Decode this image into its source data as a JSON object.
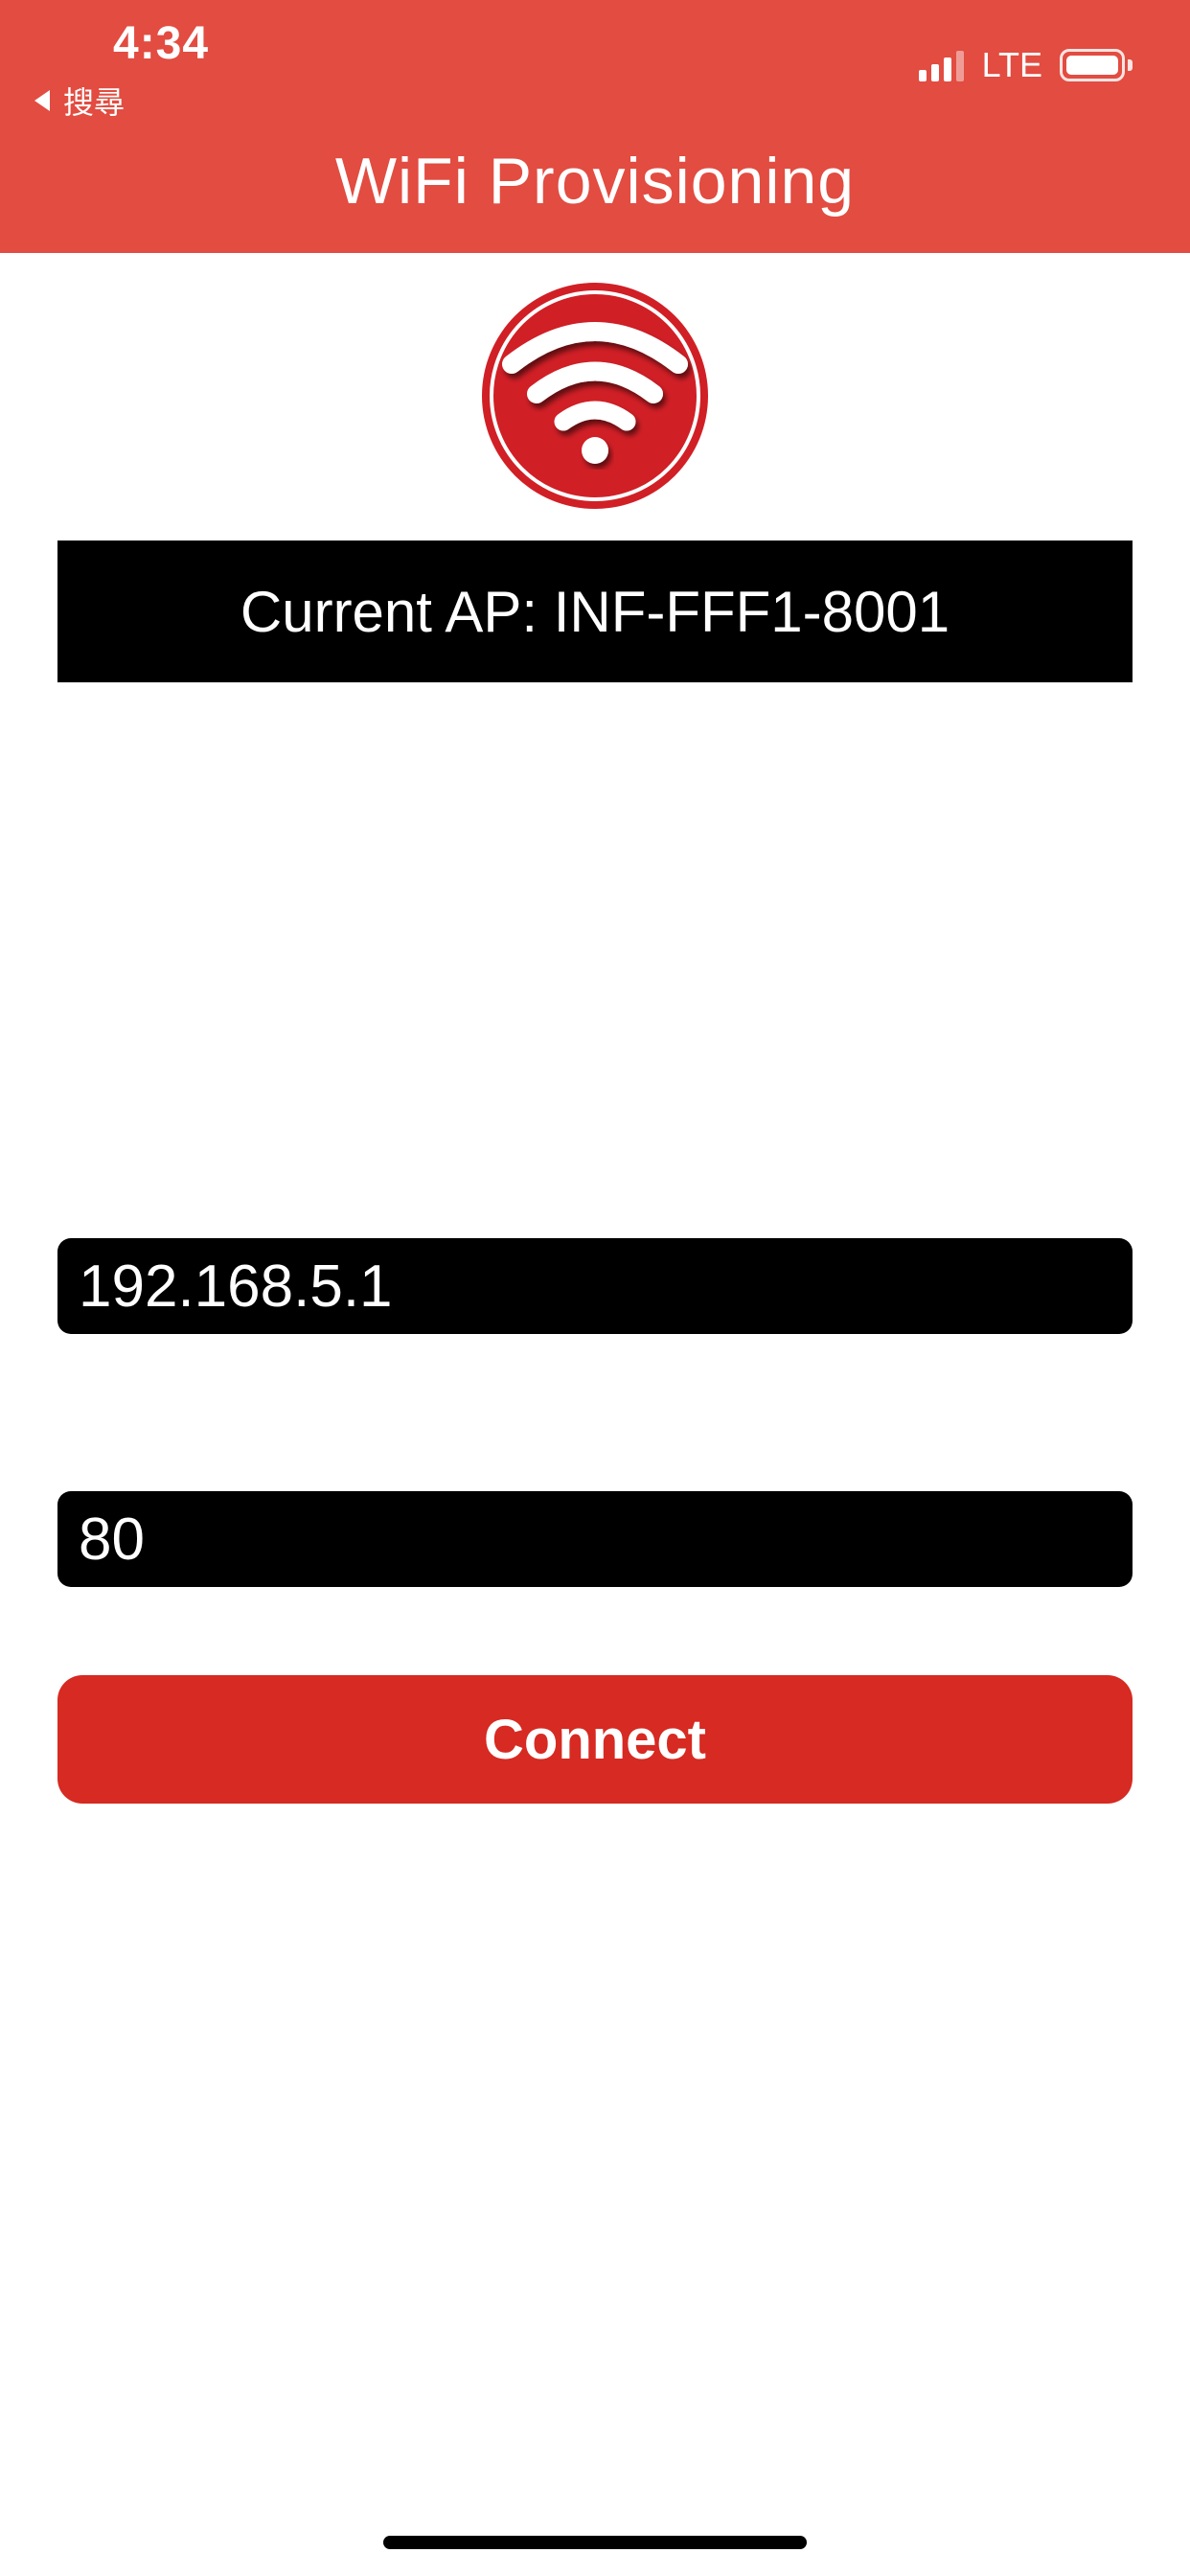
{
  "status_bar": {
    "time": "4:34",
    "back_label": "搜尋",
    "network": "LTE",
    "signal_bars_filled": 3,
    "signal_bars_total": 4,
    "battery_level": 1.0
  },
  "header": {
    "title": "WiFi Provisioning",
    "background_color": "#e24c41"
  },
  "logo": {
    "icon": "wifi-icon",
    "color": "#d11f26"
  },
  "current_ap": {
    "text": "Current AP: INF-FFF1-8001"
  },
  "form": {
    "ip_value": "192.168.5.1",
    "port_value": "80",
    "connect_label": "Connect",
    "connect_color": "#d62a22"
  }
}
